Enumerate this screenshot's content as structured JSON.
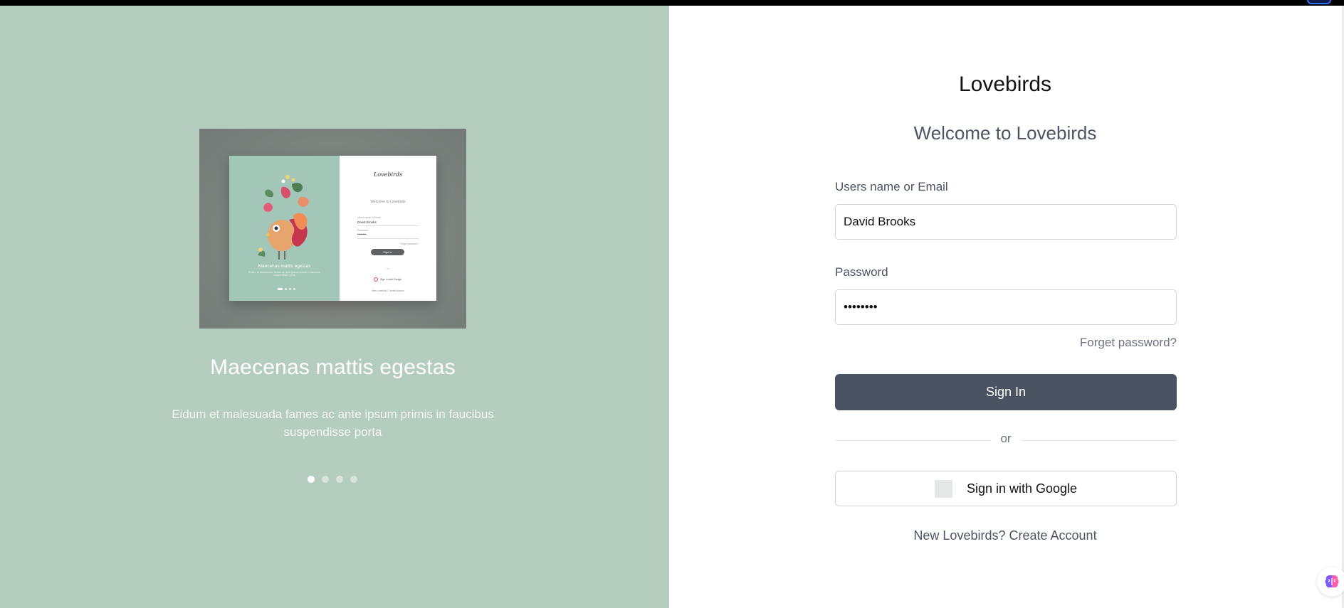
{
  "colors": {
    "left_panel_bg": "#b5cdbf",
    "primary_button": "#4a5361",
    "text_muted": "#4b5563"
  },
  "carousel": {
    "title": "Maecenas mattis egestas",
    "description": "Eidum et malesuada fames ac ante ipsum primis in faucibus suspendisse porta",
    "slide_count": 4,
    "active_index": 0,
    "preview": {
      "logo": "Lovebirds",
      "welcome": "Welcome to Lovebirds",
      "user_label": "Users name or Email",
      "user_value": "David Brooks",
      "password_label": "Password",
      "password_value": "••••••••",
      "forgot": "Forget password?",
      "sign_in": "Sign In",
      "or": "or",
      "google": "Sign in with Google",
      "new_account": "New Lovebirds? Create Account",
      "slide_title": "Maecenas mattis egestas",
      "slide_desc": "Eidum et malesuada fames ac ante ipsum primis in faucibus suspendisse porta"
    }
  },
  "form": {
    "app_title": "Lovebirds",
    "welcome": "Welcome to Lovebirds",
    "username_label": "Users name or Email",
    "username_value": "David Brooks",
    "password_label": "Password",
    "password_value": "12345678",
    "forgot_label": "Forget password?",
    "sign_in_label": "Sign In",
    "or_label": "or",
    "google_label": "Sign in with Google",
    "new_prefix": "New Lovebirds?",
    "create_label": "Create Account"
  }
}
